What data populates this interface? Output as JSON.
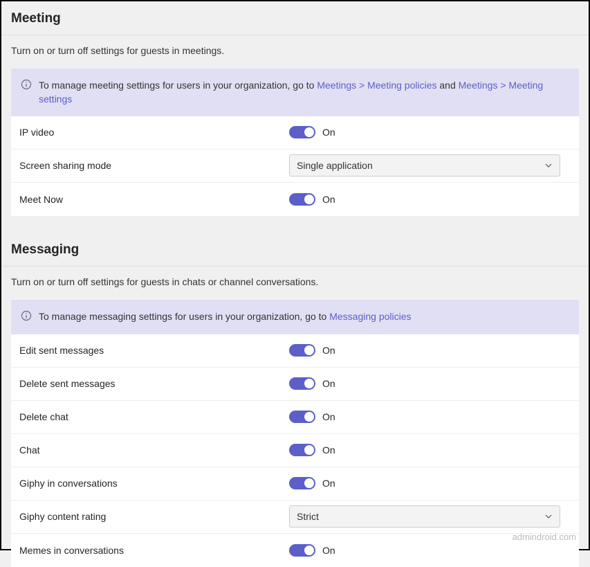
{
  "meeting": {
    "title": "Meeting",
    "desc": "Turn on or turn off settings for guests in meetings.",
    "banner_prefix": "To manage meeting settings for users in your organization, go to ",
    "link1": "Meetings > Meeting policies",
    "conj": " and ",
    "link2": "Meetings > Meeting settings",
    "rows": {
      "ip_video": {
        "label": "IP video",
        "state": "On"
      },
      "screen_sharing": {
        "label": "Screen sharing mode",
        "value": "Single application"
      },
      "meet_now": {
        "label": "Meet Now",
        "state": "On"
      }
    }
  },
  "messaging": {
    "title": "Messaging",
    "desc": "Turn on or turn off settings for guests in chats or channel conversations.",
    "banner_prefix": "To manage messaging settings for users in your organization, go to ",
    "link1": "Messaging policies",
    "rows": {
      "edit_sent": {
        "label": "Edit sent messages",
        "state": "On"
      },
      "delete_sent": {
        "label": "Delete sent messages",
        "state": "On"
      },
      "delete_chat": {
        "label": "Delete chat",
        "state": "On"
      },
      "chat": {
        "label": "Chat",
        "state": "On"
      },
      "giphy": {
        "label": "Giphy in conversations",
        "state": "On"
      },
      "giphy_rating": {
        "label": "Giphy content rating",
        "value": "Strict"
      },
      "memes": {
        "label": "Memes in conversations",
        "state": "On"
      }
    }
  },
  "watermark": "admindroid.com"
}
